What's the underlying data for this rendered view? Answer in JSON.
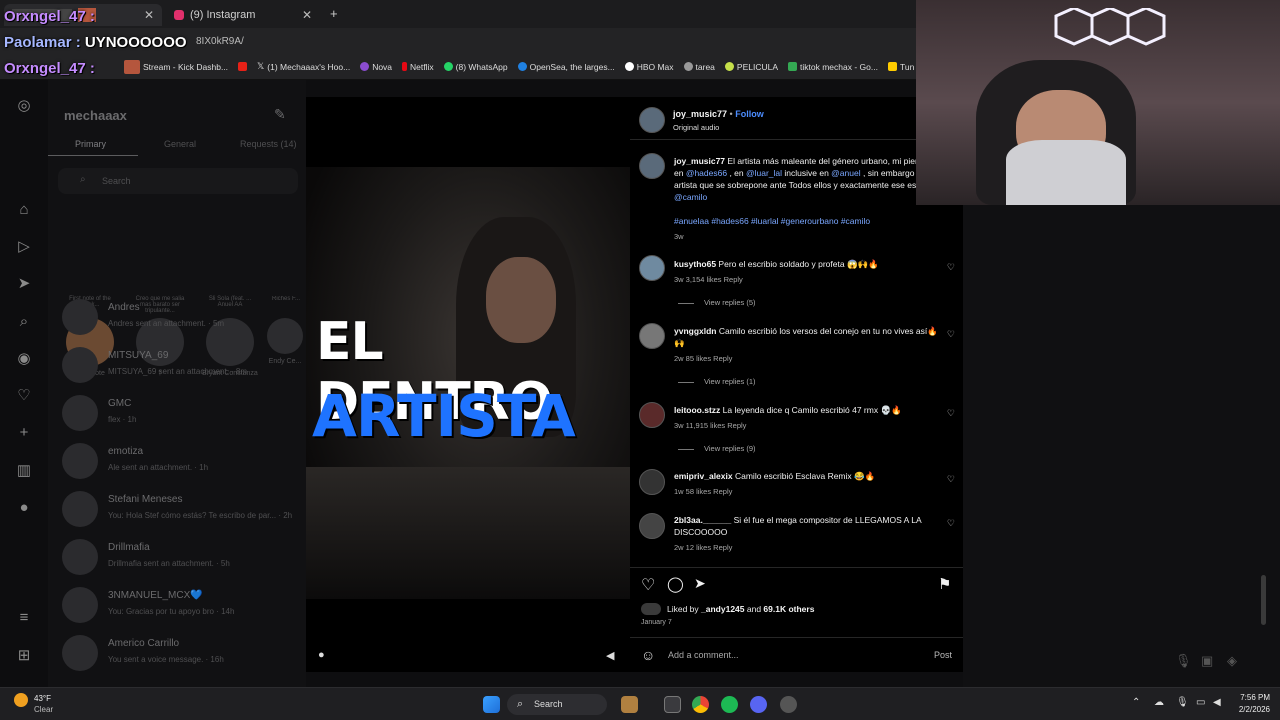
{
  "browser": {
    "tabs": [
      {
        "label": "",
        "active": true
      },
      {
        "label": "(9) Instagram",
        "active": false
      }
    ],
    "address": "8IX0kR9A/",
    "bookmarks": [
      "Stream - Kick Dashb...",
      "",
      "(1) Mechaaax's Hoo...",
      "Nova",
      "Netflix",
      "(8) WhatsApp",
      "OpenSea, the larges...",
      "HBO Max",
      "tarea",
      "PELICULA",
      "tiktok mechax - Go...",
      "Tun"
    ]
  },
  "stream_overlay": {
    "line1": "Orxngel_47 :",
    "line2_user": "Paolamar :",
    "line2_msg": "UYNOOOOOO",
    "line3": "Orxngel_47 :"
  },
  "dm": {
    "account": "mechaaax",
    "tabs": [
      "Primary",
      "General",
      "Requests (14)"
    ],
    "search_placeholder": "Search",
    "notes": [
      {
        "note": "First note of the week...",
        "name": "Your note"
      },
      {
        "note": "Creo que me salia mas barato ser tripulante...",
        "name": "†"
      },
      {
        "note": "Sli Sola (feat. ... Anuel AA",
        "name": "Bryant Constanza"
      },
      {
        "note": "Riches F...",
        "name": "Endy Ce..."
      }
    ],
    "threads": [
      {
        "name": "Andres",
        "sub": "Andres sent an attachment. · 5m"
      },
      {
        "name": "MITSUYA_69",
        "sub": "MITSUYA_69 sent an attachment. · 8m"
      },
      {
        "name": "GMC",
        "sub": "flex · 1h"
      },
      {
        "name": "emotiza",
        "sub": "Ale sent an attachment. · 1h"
      },
      {
        "name": "Stefani Meneses",
        "sub": "You: Hola Stef cómo estás? Te escribo de par... · 2h"
      },
      {
        "name": "Drillmafia",
        "sub": "Drillmafia sent an attachment. · 5h"
      },
      {
        "name": "3NMANUEL_MCX💙",
        "sub": "You: Gracias por tu apoyo bro · 14h"
      },
      {
        "name": "Americo Carrillo",
        "sub": "You sent a voice message. · 16h"
      }
    ]
  },
  "video": {
    "caption_line1": "EL DENTRO",
    "caption_line2": "ARTISTA"
  },
  "post": {
    "author": "joy_music77",
    "follow": "Follow",
    "audio": "Original audio",
    "caption_user": "joy_music77",
    "caption_text": "El artista más maleante del género urbano, mi piensan en ",
    "mention1": "@hades66",
    "caption_mid1": " , en ",
    "mention2": "@luar_lal",
    "caption_mid2": " inclusive en ",
    "mention3": "@anuel",
    "caption_mid3": " , sin embargo hay un artista que se sobrepone ante Todos ellos y exactamente ese es ",
    "mention4": "@camilo",
    "hashtags": "#anuelaa #hades66 #luarlal #generourbano #camilo",
    "caption_age": "3w",
    "comments": [
      {
        "user": "kusytho65",
        "text": "Pero el escribio soldado y profeta 😱🙌🔥",
        "meta": "3w   3,154 likes   Reply",
        "replies": "View replies (5)"
      },
      {
        "user": "yvnggxldn",
        "text": "Camilo escribió los versos del conejo en tu no vives así🔥🙌",
        "meta": "2w   85 likes   Reply",
        "replies": "View replies (1)"
      },
      {
        "user": "leitooo.stzz",
        "text": "La leyenda dice q Camilo escribió 47 rmx 💀🔥",
        "meta": "3w   11,915 likes   Reply",
        "replies": "View replies (9)"
      },
      {
        "user": "emipriv_alexix",
        "text": "Camilo escribió Esclava Remix 😂🔥",
        "meta": "1w   58 likes   Reply",
        "replies": ""
      },
      {
        "user": "2bl3aa.______",
        "text": "Si él fue el mega compositor de LLEGAMOS A LA DISCOOOOO",
        "meta": "2w   12 likes   Reply",
        "replies": ""
      }
    ],
    "liked_by_prefix": "Liked by ",
    "liked_by_user": "_andy1245",
    "liked_by_mid": " and ",
    "liked_by_count": "69.1K others",
    "date": "January 7",
    "comment_placeholder": "Add a comment...",
    "post_button": "Post"
  },
  "taskbar": {
    "weather_temp": "43°F",
    "weather_desc": "Clear",
    "search": "Search",
    "time": "7:56 PM",
    "date": "2/2/2026"
  },
  "colors": {
    "accent_blue": "#4c8dff",
    "link": "#7aa7ff",
    "caption_blue": "#1e73ff"
  }
}
